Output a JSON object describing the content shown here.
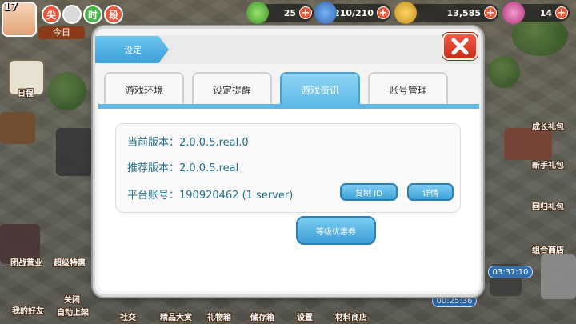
{
  "hud": {
    "level": "17",
    "time_chips": [
      "尖",
      "时",
      "段"
    ],
    "today": "今日",
    "resources": {
      "energy": {
        "value": "25"
      },
      "points": {
        "value": "210/210"
      },
      "coins": {
        "value": "13,585"
      },
      "gems": {
        "value": "14"
      }
    }
  },
  "side": {
    "left_top_label": "日程",
    "left_bottom_1": "团战营业",
    "left_bottom_2": "超级特惠",
    "left_bottom_3": "我的好友",
    "left_bottom_4": "关闭",
    "left_bottom_5": "自动上架",
    "right_1": "成长礼包",
    "right_2": "新手礼包",
    "right_3": "回归礼包",
    "right_4": "组合商店",
    "timer_1": "03:37:10",
    "timer_2": "00:25:36"
  },
  "bottom_bar": [
    "社交",
    "精品大赏",
    "礼物箱",
    "储存箱",
    "设置",
    "材料商店"
  ],
  "dialog": {
    "title": "设定",
    "tabs": [
      "游戏环境",
      "设定提醒",
      "游戏资讯",
      "账号管理"
    ],
    "active_tab": 2,
    "info": {
      "current_version": "当前版本：2.0.0.5.real.0",
      "recommended_version": "推荐版本：2.0.0.5.real",
      "platform_account": "平台账号：190920462 (1 server)"
    },
    "copy_id_button": "复制 ID",
    "details_button": "详情",
    "coupon_button": "等级优惠券"
  },
  "colors": {
    "accent": "#5fb9e6",
    "info_text": "#1e6d8a",
    "close_red": "#e03a24"
  }
}
